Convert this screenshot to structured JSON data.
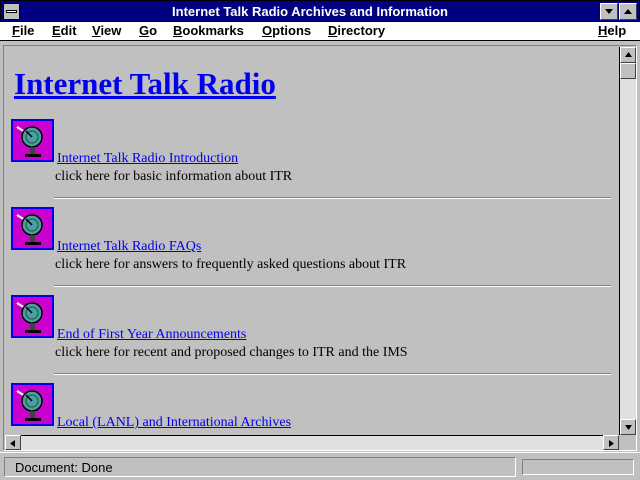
{
  "window": {
    "title": "Internet Talk Radio Archives and Information"
  },
  "menu": {
    "items": [
      "File",
      "Edit",
      "View",
      "Go",
      "Bookmarks",
      "Options",
      "Directory"
    ],
    "help": "Help"
  },
  "page": {
    "heading": "Internet Talk Radio",
    "entries": [
      {
        "link": "Internet Talk Radio Introduction",
        "description": "click here for basic information about ITR",
        "icon": "satellite-dish-icon"
      },
      {
        "link": "Internet Talk Radio FAQs",
        "description": "click here for answers to frequently asked questions about ITR",
        "icon": "satellite-dish-icon"
      },
      {
        "link": "End of First Year Announcements",
        "description": "click here for recent and proposed changes to ITR and the IMS",
        "icon": "satellite-dish-icon"
      },
      {
        "link": "Local (LANL) and International Archives",
        "description": "",
        "icon": "satellite-dish-icon"
      }
    ]
  },
  "status": {
    "text": "Document: Done"
  },
  "colors": {
    "title_bar": "#000080",
    "link": "#0000ee",
    "icon_background": "#cc00cc",
    "window_background": "#c0c0c0"
  }
}
